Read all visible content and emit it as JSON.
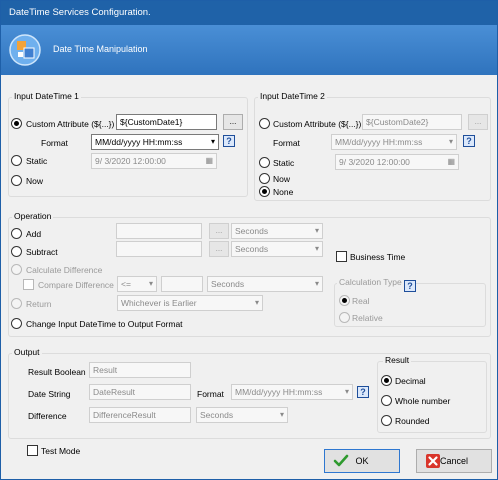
{
  "window": {
    "title": "DateTime Services Configuration."
  },
  "banner": {
    "title": "Date Time Manipulation"
  },
  "input1": {
    "group_label": "Input DateTime 1",
    "custom_label": "Custom Attribute (${...})",
    "custom_value": "${CustomDate1}",
    "ellipsis": "...",
    "format_label": "Format",
    "format_value": "MM/dd/yyyy HH:mm:ss",
    "static_label": "Static",
    "static_value": "9/  3/2020 12:00:00",
    "now_label": "Now"
  },
  "input2": {
    "group_label": "Input DateTime 2",
    "custom_label": "Custom Attribute (${...})",
    "custom_value": "${CustomDate2}",
    "ellipsis": "...",
    "format_label": "Format",
    "format_value": "MM/dd/yyyy HH:mm:ss",
    "static_label": "Static",
    "static_value": "9/  3/2020 12:00:00",
    "now_label": "Now",
    "none_label": "None"
  },
  "operation": {
    "group_label": "Operation",
    "add_label": "Add",
    "add_unit": "Seconds",
    "subtract_label": "Subtract",
    "subtract_unit": "Seconds",
    "calc_diff_label": "Calculate Difference",
    "compare_label": "Compare Difference",
    "compare_op": "<=",
    "compare_unit": "Seconds",
    "return_label": "Return",
    "return_value": "Whichever is Earlier",
    "change_label": "Change Input DateTime to Output Format",
    "business_time_label": "Business Time",
    "calc_type_label": "Calculation Type",
    "real_label": "Real",
    "relative_label": "Relative",
    "ellipsis": "..."
  },
  "output": {
    "group_label": "Output",
    "result_boolean_label": "Result Boolean",
    "result_boolean_value": "Result",
    "date_string_label": "Date String",
    "date_string_value": "DateResult",
    "format_label": "Format",
    "format_value": "MM/dd/yyyy HH:mm:ss",
    "difference_label": "Difference",
    "difference_value": "DifferenceResult",
    "difference_unit": "Seconds",
    "result_group_label": "Result",
    "decimal_label": "Decimal",
    "whole_label": "Whole number",
    "rounded_label": "Rounded"
  },
  "footer": {
    "test_mode_label": "Test Mode",
    "ok_label": "OK",
    "cancel_label": "Cancel"
  },
  "help_glyph": "?",
  "dropdown_glyph": "▾",
  "calendar_glyph": "▦"
}
